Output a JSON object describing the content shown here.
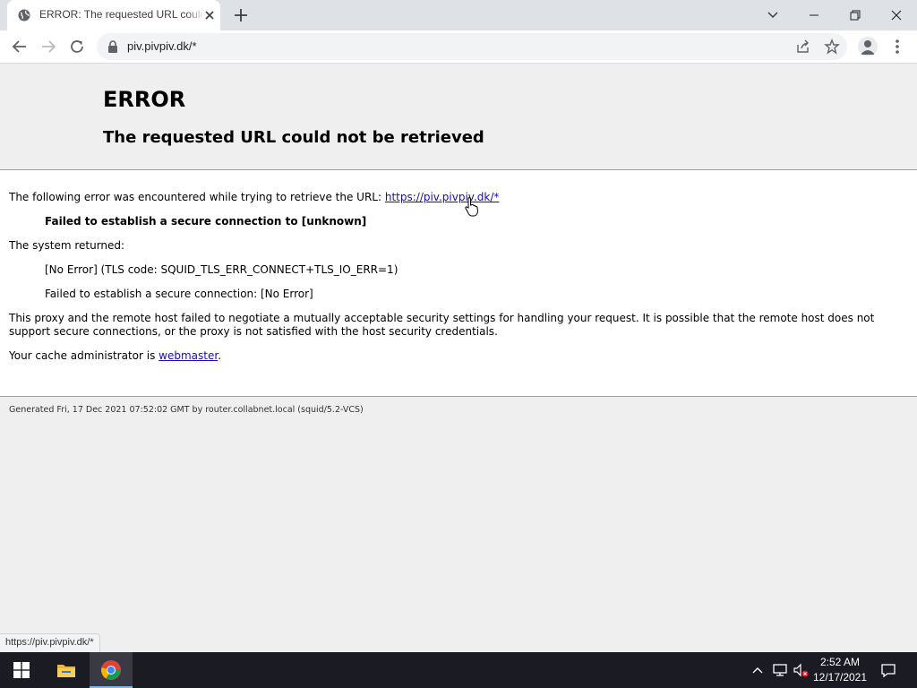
{
  "browser": {
    "tab": {
      "title": "ERROR: The requested URL could not be retrieved"
    },
    "address_bar": {
      "url": "piv.pivpiv.dk/*"
    },
    "status_bar": {
      "text": "https://piv.pivpiv.dk/*"
    }
  },
  "page": {
    "heading": "ERROR",
    "subheading": "The requested URL could not be retrieved",
    "intro_text": "The following error was encountered while trying to retrieve the URL: ",
    "intro_link": "https://piv.pivpiv.dk/*",
    "error_title": "Failed to establish a secure connection to [unknown]",
    "system_returned": "The system returned:",
    "tls_code": "[No Error] (TLS code: SQUID_TLS_ERR_CONNECT+TLS_IO_ERR=1)",
    "secure_fail": "Failed to establish a secure connection: [No Error]",
    "explanation": "This proxy and the remote host failed to negotiate a mutually acceptable security settings for handling your request. It is possible that the remote host does not support secure connections, or the proxy is not satisfied with the host security credentials.",
    "admin_prefix": "Your cache administrator is ",
    "admin_link": "webmaster",
    "admin_suffix": ".",
    "footer": "Generated Fri, 17 Dec 2021 07:52:02 GMT by router.collabnet.local (squid/5.2-VCS)"
  },
  "taskbar": {
    "time": "2:52 AM",
    "date": "12/17/2021"
  },
  "colors": {
    "link": "#1a0dab",
    "taskbar": "#1b1b24",
    "tab_strip": "#dee1e6"
  }
}
